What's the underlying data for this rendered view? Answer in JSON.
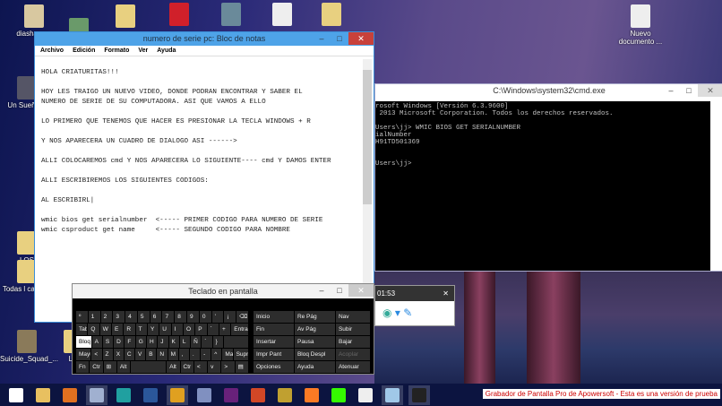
{
  "desktop": {
    "icons": [
      {
        "label": "diashapes-",
        "color": "#d8c8a0"
      },
      {
        "label": "",
        "color": "#6a9a6a"
      },
      {
        "label": "",
        "color": "#e8d080"
      },
      {
        "label": "",
        "color": "#d0202a"
      },
      {
        "label": "",
        "color": "#6a8a9a"
      },
      {
        "label": "",
        "color": "#eeeeee"
      },
      {
        "label": "",
        "color": "#e8d080"
      },
      {
        "label": "Nuevo documento ...",
        "color": "#eeeeee"
      },
      {
        "label": "Un Sueño P",
        "color": "#556"
      },
      {
        "label": "LOS",
        "color": "#e8d080"
      },
      {
        "label": "Todas l carpeta",
        "color": "#e8d080"
      },
      {
        "label": "Suicide_Squad_...",
        "color": "#8a7a5a"
      },
      {
        "label": "LO",
        "color": "#e8d080"
      }
    ]
  },
  "notepad": {
    "title": "numero de serie pc: Bloc de notas",
    "menu": [
      "Archivo",
      "Edición",
      "Formato",
      "Ver",
      "Ayuda"
    ],
    "text": "HOLA CRIATURITAS!!!\n\nHOY LES TRAIGO UN NUEVO VIDEO, DONDE PODRAN ENCONTRAR Y SABER EL\nNUMERO DE SERIE DE SU COMPUTADORA. ASI QUE VAMOS A ELLO\n\nLO PRIMERO QUE TENEMOS QUE HACER ES PRESIONAR LA TECLA WINDOWS + R\n\nY NOS APARECERA UN CUADRO DE DIALOGO ASI ------>\n\nALLI COLOCAREMOS cmd Y NOS APARECERA LO SIGUIENTE---- cmd Y DAMOS ENTER\n\nALLI ESCRIBIREMOS LOS SIGUIENTES CODIGOS:\n\nAL ESCRIBIRL|\n\nwmic bios get serialnumber  <----- PRIMER CODIGO PARA NUMERO DE SERIE\nwmic csproduct get name     <----- SEGUNDO CODIGO PARA NOMBRE"
  },
  "cmd": {
    "title": "C:\\Windows\\system32\\cmd.exe",
    "text": "rosoft Windows [Versión 6.3.9600]\n 2013 Microsoft Corporation. Todos los derechos reservados.\n\nUsers\\jj> WMIC BIOS GET SERIALNUMBER\nialNumber\nH91TD501369\n\n\nUsers\\jj>"
  },
  "recorder": {
    "time": "01:53",
    "close": "✕"
  },
  "keyboard": {
    "title": "Teclado en pantalla",
    "rows": [
      [
        "º",
        "1",
        "2",
        "3",
        "4",
        "5",
        "6",
        "7",
        "8",
        "9",
        "0",
        "'",
        "¡",
        "⌫"
      ],
      [
        "Tab",
        "Q",
        "W",
        "E",
        "R",
        "T",
        "Y",
        "U",
        "I",
        "O",
        "P",
        "`",
        "+",
        "Entrar"
      ],
      [
        "Bloq M",
        "A",
        "S",
        "D",
        "F",
        "G",
        "H",
        "J",
        "K",
        "L",
        "Ñ",
        "´",
        "}",
        ""
      ],
      [
        "Mayús",
        "<",
        "Z",
        "X",
        "C",
        "V",
        "B",
        "N",
        "M",
        ",",
        ".",
        "-",
        "^",
        "Ma",
        "Supr"
      ],
      [
        "Fn",
        "Ctr",
        "⊞",
        "Alt",
        "",
        "Alt",
        "Ctr",
        "<",
        "v",
        ">",
        "▤"
      ]
    ],
    "nav": [
      [
        "Inicio",
        "Re Pág",
        "Nav"
      ],
      [
        "Fin",
        "Av Pág",
        "Subir"
      ],
      [
        "Insertar",
        "Pausa",
        "Bajar"
      ],
      [
        "Impr Pant",
        "Bloq Despl",
        "Acoplar"
      ],
      [
        "Opciones",
        "Ayuda",
        "Atenuar"
      ]
    ]
  },
  "taskbar": {
    "apps": [
      {
        "name": "start",
        "color": "#ffffff"
      },
      {
        "name": "explorer",
        "color": "#e8c060"
      },
      {
        "name": "media",
        "color": "#e07020"
      },
      {
        "name": "remote",
        "color": "#a0b0d0"
      },
      {
        "name": "eset",
        "color": "#20a0a0"
      },
      {
        "name": "word",
        "color": "#2b579a"
      },
      {
        "name": "chrome",
        "color": "#e0a020"
      },
      {
        "name": "paint",
        "color": "#8090c0"
      },
      {
        "name": "visual-studio",
        "color": "#68217a"
      },
      {
        "name": "powerpoint",
        "color": "#d24726"
      },
      {
        "name": "app",
        "color": "#c0a030"
      },
      {
        "name": "xampp",
        "color": "#fb7a24"
      },
      {
        "name": "dreamweaver",
        "color": "#35fa00"
      },
      {
        "name": "app2",
        "color": "#eeeeee"
      },
      {
        "name": "notepad",
        "color": "#a0c8e8"
      },
      {
        "name": "cmd",
        "color": "#222222"
      }
    ],
    "banner": "Grabador de Pantalla Pro de Apowersoft - Esta es una versión de prueba"
  }
}
